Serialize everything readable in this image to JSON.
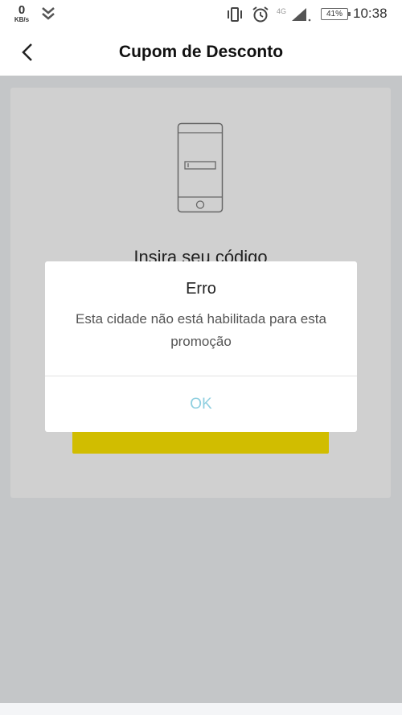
{
  "status_bar": {
    "net_speed_value": "0",
    "net_speed_unit": "KB/s",
    "network_type": "4G",
    "battery": "41%",
    "time": "10:38",
    "icons": [
      "download-icon",
      "vibrate-icon",
      "alarm-icon",
      "signal-icon",
      "battery-icon"
    ]
  },
  "header": {
    "title": "Cupom de Desconto",
    "back_icon": "back-arrow-icon"
  },
  "card": {
    "heading": "Insira seu código",
    "illustration": "phone-with-input-icon"
  },
  "dialog": {
    "title": "Erro",
    "message": "Esta cidade não está habilitada para esta promoção",
    "ok_label": "OK"
  },
  "colors": {
    "overlay": "#c4c6c8",
    "accent_yellow": "#d1bd00",
    "ok_text": "#8fcfe0"
  }
}
